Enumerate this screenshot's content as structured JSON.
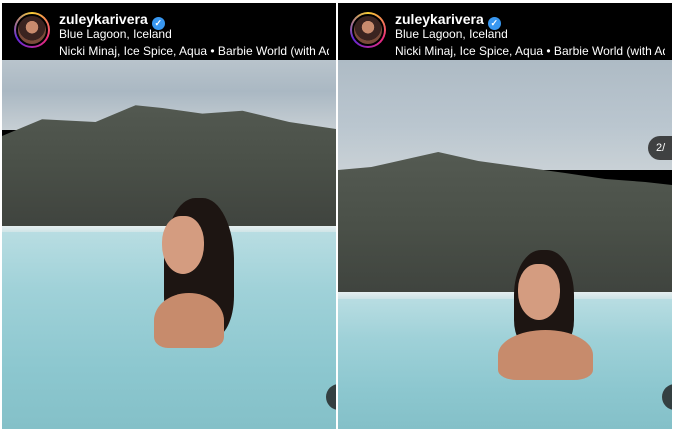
{
  "posts": [
    {
      "username": "zuleykarivera",
      "verified_mark": "✓",
      "location": "Blue Lagoon, Iceland",
      "music": "Nicki Minaj, Ice Spice, Aqua • Barbie World (with Aq…"
    },
    {
      "username": "zuleykarivera",
      "verified_mark": "✓",
      "location": "Blue Lagoon, Iceland",
      "music": "Nicki Minaj, Ice Spice, Aqua • Barbie World (with Aq…",
      "page_indicator": "2/"
    }
  ],
  "colors": {
    "verified_badge": "#3897f0",
    "water": "#9fd1d8",
    "header_bg": "#000000"
  },
  "icons": {
    "verified": "verified-badge-icon"
  }
}
